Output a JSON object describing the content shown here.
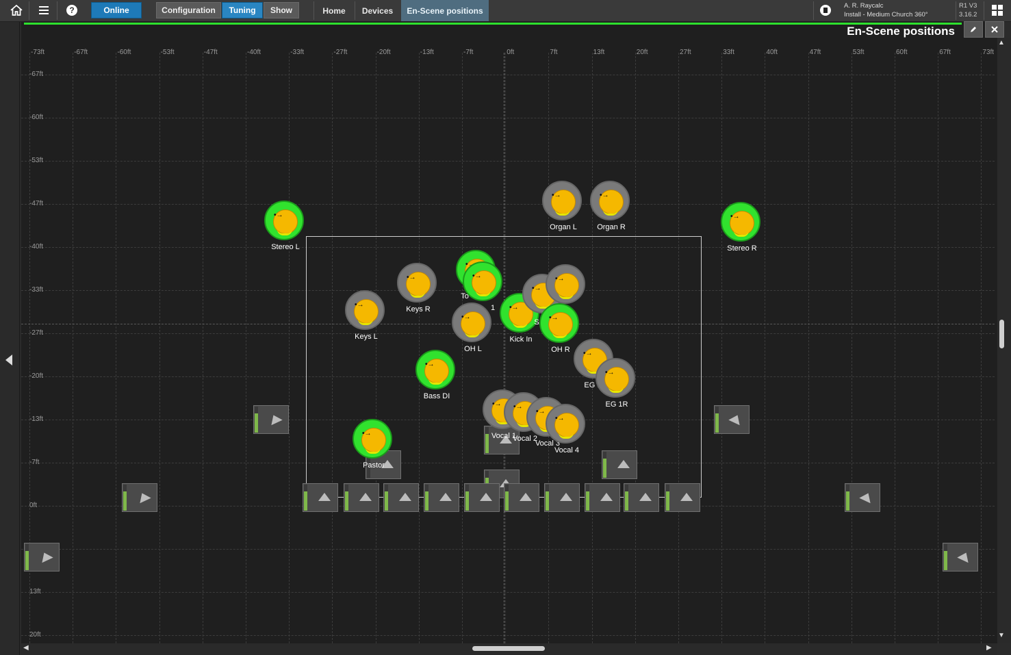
{
  "topbar": {
    "online_label": "Online",
    "config_label": "Configuration",
    "tuning_label": "Tuning",
    "show_label": "Show",
    "tabs": [
      {
        "label": "Home"
      },
      {
        "label": "Devices"
      },
      {
        "label": "En-Scene positions"
      }
    ],
    "user_line1": "A. R. Raycalc",
    "user_line2": "Install - Medium Church 360°",
    "version_line1": "R1 V3",
    "version_line2": "3.16.2",
    "icons": {
      "home": "home-icon",
      "menu": "menu-icon",
      "help": "help-icon",
      "record": "record-icon",
      "layout": "grid-layout-icon"
    }
  },
  "page": {
    "title": "En-Scene positions",
    "edit_icon": "pencil-icon",
    "close_icon": "close-icon"
  },
  "grid": {
    "x_ticks": [
      "-73ft",
      "-67ft",
      "-60ft",
      "-53ft",
      "-47ft",
      "-40ft",
      "-33ft",
      "-27ft",
      "-20ft",
      "-13ft",
      "-7ft",
      "0ft",
      "7ft",
      "13ft",
      "20ft",
      "27ft",
      "33ft",
      "40ft",
      "47ft",
      "53ft",
      "60ft",
      "67ft",
      "73ft"
    ],
    "y_ticks": [
      "-67ft",
      "-60ft",
      "-53ft",
      "-47ft",
      "-40ft",
      "-33ft",
      "-27ft",
      "-20ft",
      "-13ft",
      "-7ft",
      "0ft",
      "",
      "13ft",
      "20ft"
    ]
  },
  "sources": [
    {
      "label": "Stereo L"
    },
    {
      "label": "Organ L"
    },
    {
      "label": "Organ R"
    },
    {
      "label": "Stereo R"
    },
    {
      "label": "Keys R"
    },
    {
      "label": "Keys L"
    },
    {
      "label": "To"
    },
    {
      "label": "1"
    },
    {
      "label": "OH L"
    },
    {
      "label": "Kick In"
    },
    {
      "label": "S"
    },
    {
      "label": ""
    },
    {
      "label": "OH R"
    },
    {
      "label": "Bass DI"
    },
    {
      "label": "EG 1L"
    },
    {
      "label": "EG 1R"
    },
    {
      "label": "Vocal 1"
    },
    {
      "label": "Vocal 2"
    },
    {
      "label": "Vocal 3"
    },
    {
      "label": "Vocal 4"
    },
    {
      "label": "Pastor"
    }
  ]
}
